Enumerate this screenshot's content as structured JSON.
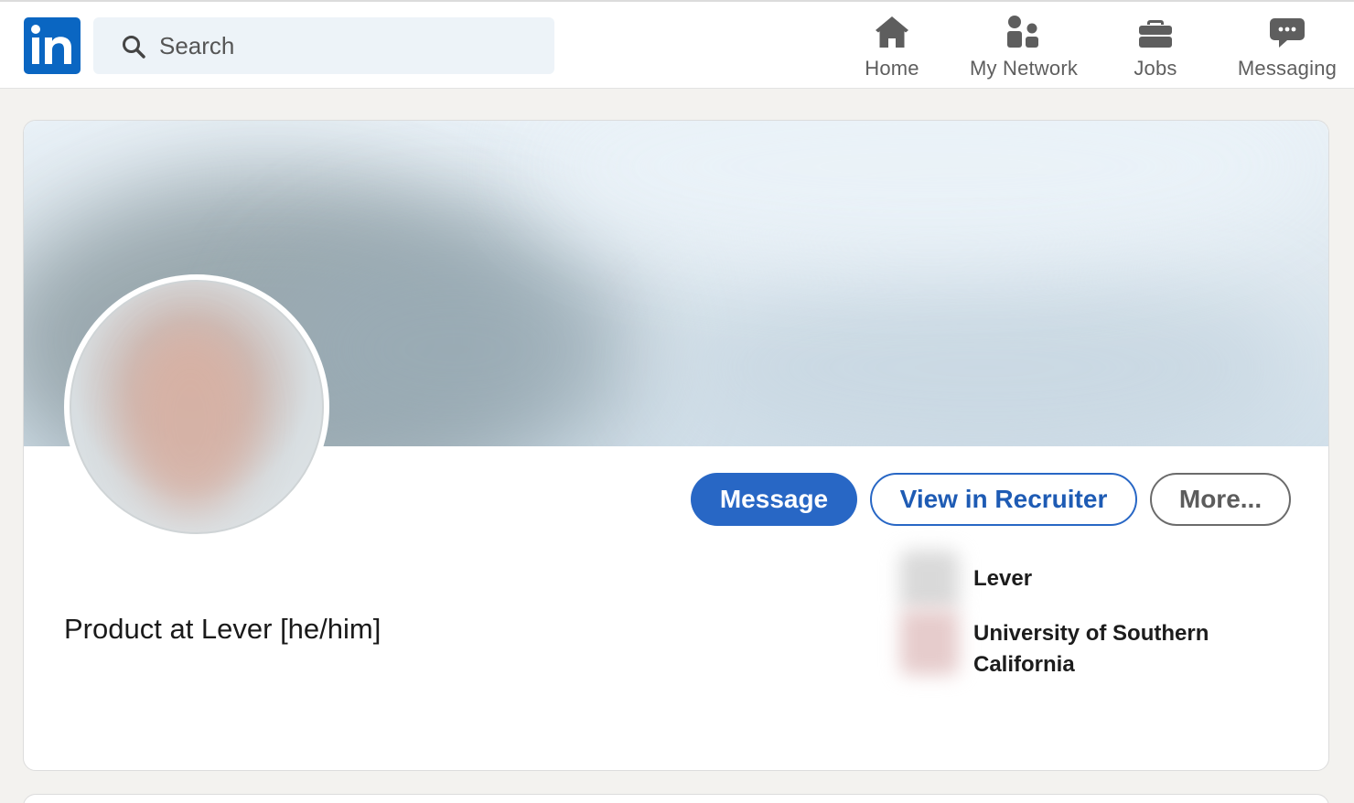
{
  "nav": {
    "search_placeholder": "Search",
    "items": [
      {
        "label": "Home",
        "icon": "home-icon"
      },
      {
        "label": "My Network",
        "icon": "my-network-icon"
      },
      {
        "label": "Jobs",
        "icon": "jobs-icon"
      },
      {
        "label": "Messaging",
        "icon": "messaging-icon"
      }
    ]
  },
  "profile": {
    "headline": "Product at Lever [he/him]",
    "actions": {
      "message": "Message",
      "recruiter": "View in Recruiter",
      "more": "More..."
    },
    "experience": {
      "company": "Lever",
      "school": "University of Southern California"
    }
  },
  "colors": {
    "brand": "#0a66c2",
    "primary_button": "#2867c5",
    "page_bg": "#f3f2ef"
  }
}
